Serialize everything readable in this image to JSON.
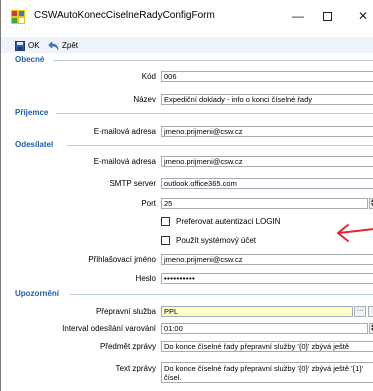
{
  "window": {
    "title": "CSWAutoKonecCiselneRadyConfigForm",
    "minimize_glyph": "—",
    "close_glyph": "✕"
  },
  "toolbar": {
    "ok_label": "OK",
    "back_label": "Zpět"
  },
  "groups": {
    "obecne": "Obecné",
    "prijemce": "Příjemce",
    "odesilatel": "Odesílatel",
    "upozorneni": "Upozornění"
  },
  "obecne": {
    "kod_label": "Kód",
    "kod_value": "006",
    "nazev_label": "Název",
    "nazev_value": "Expediční doklady - info o konci číselné řady"
  },
  "prijemce": {
    "email_label": "E-mailová adresa",
    "email_value": "jmeno.prijmeni@csw.cz"
  },
  "odesilatel": {
    "email_label": "E-mailová adresa",
    "email_value": "jmeno.prijmeni@csw.cz",
    "smtp_label": "SMTP server",
    "smtp_value": "outlook.office365.com",
    "port_label": "Port",
    "port_value": "25",
    "pref_login_label": "Preferovat autentizaci LOGIN",
    "pref_login_checked": false,
    "system_account_label": "Použít systémový účet",
    "system_account_checked": false,
    "login_label": "Přihlašovací jméno",
    "login_value": "jmeno.prijmeni@csw.cz",
    "password_label": "Heslo",
    "password_value": "••••••••••"
  },
  "upozorneni": {
    "service_label": "Přepravní služba",
    "service_value": "PPL",
    "service_btn": "···",
    "interval_label": "Interval odesílání varování",
    "interval_value": "01:00",
    "subject_label": "Předmět zprávy",
    "subject_value": "Do konce číselné řady přepravní služby '{0}' zbývá ještě",
    "text_label": "Text zprávy",
    "text_value": "Do konce číselné řady přepravní služby '{0}' zbývá ještě '{1}' čísel."
  },
  "annotation": {
    "arrow_color": "#e0282e"
  },
  "colors": {
    "group_header": "#1f5fb0",
    "toolbar_bg": "#eef3fa",
    "highlight_field": "#ffffc8"
  }
}
